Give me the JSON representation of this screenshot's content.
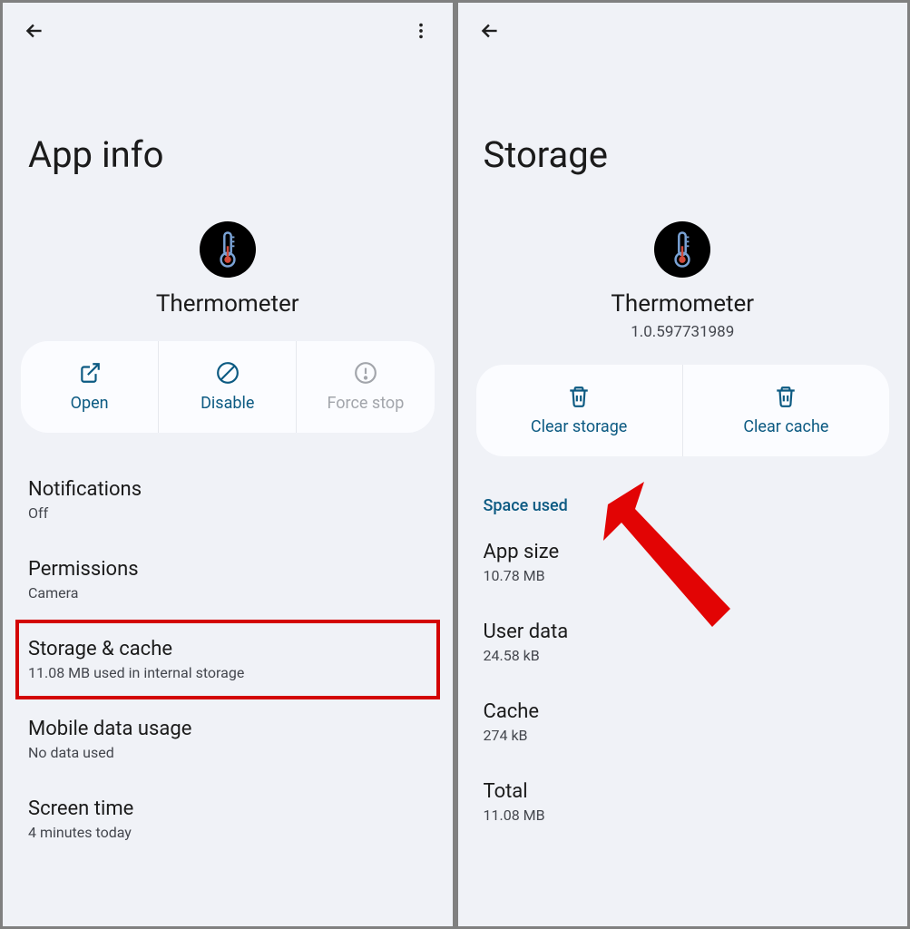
{
  "left": {
    "title": "App info",
    "appName": "Thermometer",
    "actions": {
      "open": "Open",
      "disable": "Disable",
      "forceStop": "Force stop"
    },
    "items": [
      {
        "title": "Notifications",
        "sub": "Off"
      },
      {
        "title": "Permissions",
        "sub": "Camera"
      },
      {
        "title": "Storage & cache",
        "sub": "11.08 MB used in internal storage"
      },
      {
        "title": "Mobile data usage",
        "sub": "No data used"
      },
      {
        "title": "Screen time",
        "sub": "4 minutes today"
      }
    ]
  },
  "right": {
    "title": "Storage",
    "appName": "Thermometer",
    "version": "1.0.597731989",
    "actions": {
      "clearStorage": "Clear storage",
      "clearCache": "Clear cache"
    },
    "sectionLabel": "Space used",
    "items": [
      {
        "title": "App size",
        "sub": "10.78 MB"
      },
      {
        "title": "User data",
        "sub": "24.58 kB"
      },
      {
        "title": "Cache",
        "sub": "274 kB"
      },
      {
        "title": "Total",
        "sub": "11.08 MB"
      }
    ]
  }
}
